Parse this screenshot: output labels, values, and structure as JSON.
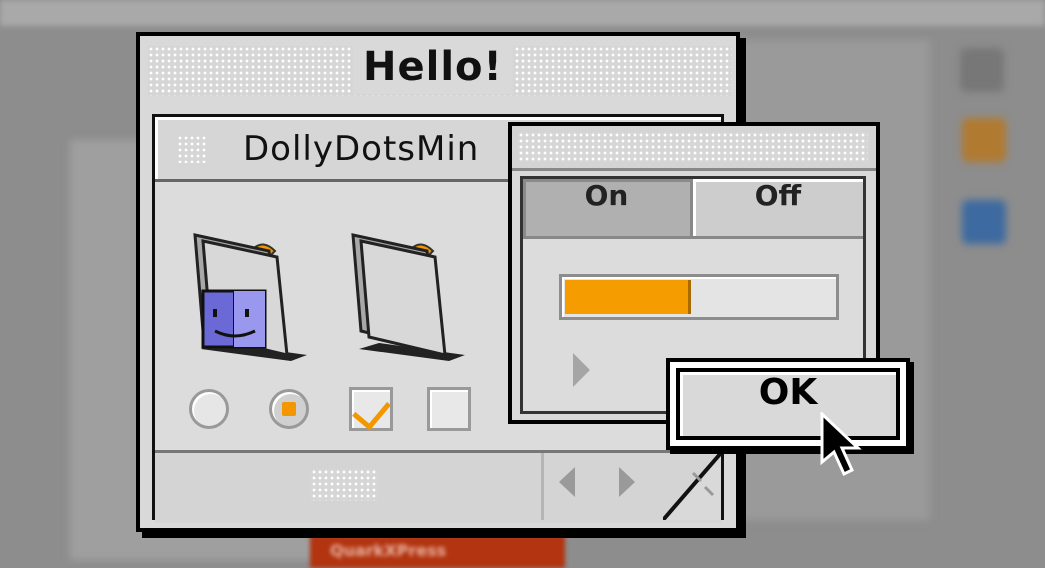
{
  "window": {
    "title": "Hello!"
  },
  "inner_window": {
    "title": "DollyDotsMin"
  },
  "controls": {
    "radio_unselected": false,
    "radio_selected": true,
    "checkbox_checked": true,
    "checkbox_unchecked": false
  },
  "palette": {
    "segments": [
      {
        "label": "On",
        "selected": true
      },
      {
        "label": "Off",
        "selected": false
      }
    ],
    "progress_fraction": 0.47
  },
  "dialog": {
    "ok_label": "OK"
  },
  "taskbar": {
    "label": "QuarkXPress"
  },
  "icons": {
    "finder_folder": "finder-folder-icon",
    "plain_folder": "folder-icon",
    "cursor": "arrow-cursor-icon",
    "disclosure": "disclosure-triangle-icon"
  },
  "colors": {
    "accent": "#f59d00",
    "finder_blue": "#6b69d6",
    "window_face": "#d9d9d9",
    "desktop": "#8d8d8d"
  }
}
